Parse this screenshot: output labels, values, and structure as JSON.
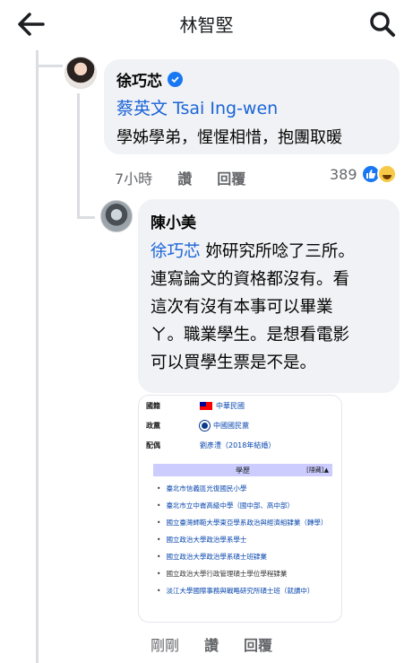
{
  "header": {
    "title": "林智堅"
  },
  "comment": {
    "author": "徐巧芯",
    "mention": "蔡英文 Tsai Ing-wen",
    "text": "學姊學弟，惺惺相惜，抱團取暖",
    "time": "7小時",
    "like_label": "讚",
    "reply_label": "回覆",
    "reaction_count": "389"
  },
  "reply": {
    "author": "陳小美",
    "mention": "徐巧芯",
    "text_line1": " 妳研究所唸了三所。",
    "text_line2": "連寫論文的資格都沒有。看",
    "text_line3": "這次有沒有本事可以畢業",
    "text_line4": "ㄚ。職業學生。是想看電影",
    "text_line5": "可以買學生票是不是。",
    "time": "剛剛",
    "like_label": "讚",
    "reply_label": "回覆"
  },
  "attachment": {
    "rows": [
      {
        "key": "國籍",
        "value": "中華民國"
      },
      {
        "key": "政黨",
        "value": "中國國民黨"
      },
      {
        "key": "配偶",
        "value": "劉彥澧（2018年結婚）"
      }
    ],
    "education_title": "學歷",
    "hide_label": "[隱藏]▲",
    "education": [
      "臺北市信義區光復國民小學",
      "臺北市立中崙高級中學（國中部、高中部）",
      "國立臺灣師範大學東亞學系政治與經濟組肄業（轉學）",
      "國立政治大學政治學系學士",
      "國立政治大學政治學系碩士班肄業",
      "國立政治大學行政管理碩士學位學程肄業",
      "淡江大學國際事務與戰略研究所碩士班（就讀中）"
    ]
  },
  "colors": {
    "accent": "#1877f2",
    "mention": "#1b64d8",
    "bubble": "#f0f2f5",
    "meta": "#65676b"
  },
  "icons": [
    "back-arrow-icon",
    "search-icon",
    "verified-icon",
    "like-reaction-icon",
    "haha-reaction-icon",
    "flag-icon",
    "party-emblem-icon"
  ]
}
